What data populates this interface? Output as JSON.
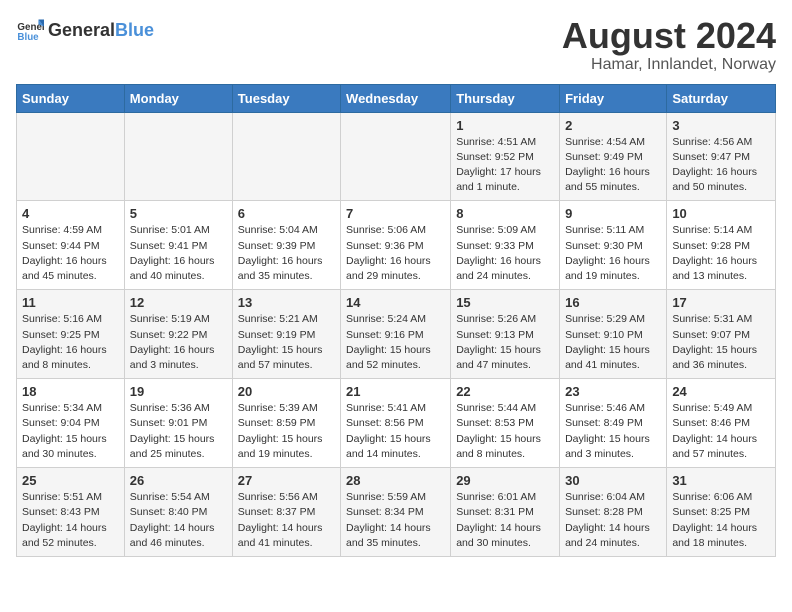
{
  "header": {
    "logo_general": "General",
    "logo_blue": "Blue",
    "title": "August 2024",
    "subtitle": "Hamar, Innlandet, Norway"
  },
  "weekdays": [
    "Sunday",
    "Monday",
    "Tuesday",
    "Wednesday",
    "Thursday",
    "Friday",
    "Saturday"
  ],
  "weeks": [
    [
      {
        "day": "",
        "info": ""
      },
      {
        "day": "",
        "info": ""
      },
      {
        "day": "",
        "info": ""
      },
      {
        "day": "",
        "info": ""
      },
      {
        "day": "1",
        "info": "Sunrise: 4:51 AM\nSunset: 9:52 PM\nDaylight: 17 hours and 1 minute."
      },
      {
        "day": "2",
        "info": "Sunrise: 4:54 AM\nSunset: 9:49 PM\nDaylight: 16 hours and 55 minutes."
      },
      {
        "day": "3",
        "info": "Sunrise: 4:56 AM\nSunset: 9:47 PM\nDaylight: 16 hours and 50 minutes."
      }
    ],
    [
      {
        "day": "4",
        "info": "Sunrise: 4:59 AM\nSunset: 9:44 PM\nDaylight: 16 hours and 45 minutes."
      },
      {
        "day": "5",
        "info": "Sunrise: 5:01 AM\nSunset: 9:41 PM\nDaylight: 16 hours and 40 minutes."
      },
      {
        "day": "6",
        "info": "Sunrise: 5:04 AM\nSunset: 9:39 PM\nDaylight: 16 hours and 35 minutes."
      },
      {
        "day": "7",
        "info": "Sunrise: 5:06 AM\nSunset: 9:36 PM\nDaylight: 16 hours and 29 minutes."
      },
      {
        "day": "8",
        "info": "Sunrise: 5:09 AM\nSunset: 9:33 PM\nDaylight: 16 hours and 24 minutes."
      },
      {
        "day": "9",
        "info": "Sunrise: 5:11 AM\nSunset: 9:30 PM\nDaylight: 16 hours and 19 minutes."
      },
      {
        "day": "10",
        "info": "Sunrise: 5:14 AM\nSunset: 9:28 PM\nDaylight: 16 hours and 13 minutes."
      }
    ],
    [
      {
        "day": "11",
        "info": "Sunrise: 5:16 AM\nSunset: 9:25 PM\nDaylight: 16 hours and 8 minutes."
      },
      {
        "day": "12",
        "info": "Sunrise: 5:19 AM\nSunset: 9:22 PM\nDaylight: 16 hours and 3 minutes."
      },
      {
        "day": "13",
        "info": "Sunrise: 5:21 AM\nSunset: 9:19 PM\nDaylight: 15 hours and 57 minutes."
      },
      {
        "day": "14",
        "info": "Sunrise: 5:24 AM\nSunset: 9:16 PM\nDaylight: 15 hours and 52 minutes."
      },
      {
        "day": "15",
        "info": "Sunrise: 5:26 AM\nSunset: 9:13 PM\nDaylight: 15 hours and 47 minutes."
      },
      {
        "day": "16",
        "info": "Sunrise: 5:29 AM\nSunset: 9:10 PM\nDaylight: 15 hours and 41 minutes."
      },
      {
        "day": "17",
        "info": "Sunrise: 5:31 AM\nSunset: 9:07 PM\nDaylight: 15 hours and 36 minutes."
      }
    ],
    [
      {
        "day": "18",
        "info": "Sunrise: 5:34 AM\nSunset: 9:04 PM\nDaylight: 15 hours and 30 minutes."
      },
      {
        "day": "19",
        "info": "Sunrise: 5:36 AM\nSunset: 9:01 PM\nDaylight: 15 hours and 25 minutes."
      },
      {
        "day": "20",
        "info": "Sunrise: 5:39 AM\nSunset: 8:59 PM\nDaylight: 15 hours and 19 minutes."
      },
      {
        "day": "21",
        "info": "Sunrise: 5:41 AM\nSunset: 8:56 PM\nDaylight: 15 hours and 14 minutes."
      },
      {
        "day": "22",
        "info": "Sunrise: 5:44 AM\nSunset: 8:53 PM\nDaylight: 15 hours and 8 minutes."
      },
      {
        "day": "23",
        "info": "Sunrise: 5:46 AM\nSunset: 8:49 PM\nDaylight: 15 hours and 3 minutes."
      },
      {
        "day": "24",
        "info": "Sunrise: 5:49 AM\nSunset: 8:46 PM\nDaylight: 14 hours and 57 minutes."
      }
    ],
    [
      {
        "day": "25",
        "info": "Sunrise: 5:51 AM\nSunset: 8:43 PM\nDaylight: 14 hours and 52 minutes."
      },
      {
        "day": "26",
        "info": "Sunrise: 5:54 AM\nSunset: 8:40 PM\nDaylight: 14 hours and 46 minutes."
      },
      {
        "day": "27",
        "info": "Sunrise: 5:56 AM\nSunset: 8:37 PM\nDaylight: 14 hours and 41 minutes."
      },
      {
        "day": "28",
        "info": "Sunrise: 5:59 AM\nSunset: 8:34 PM\nDaylight: 14 hours and 35 minutes."
      },
      {
        "day": "29",
        "info": "Sunrise: 6:01 AM\nSunset: 8:31 PM\nDaylight: 14 hours and 30 minutes."
      },
      {
        "day": "30",
        "info": "Sunrise: 6:04 AM\nSunset: 8:28 PM\nDaylight: 14 hours and 24 minutes."
      },
      {
        "day": "31",
        "info": "Sunrise: 6:06 AM\nSunset: 8:25 PM\nDaylight: 14 hours and 18 minutes."
      }
    ]
  ]
}
